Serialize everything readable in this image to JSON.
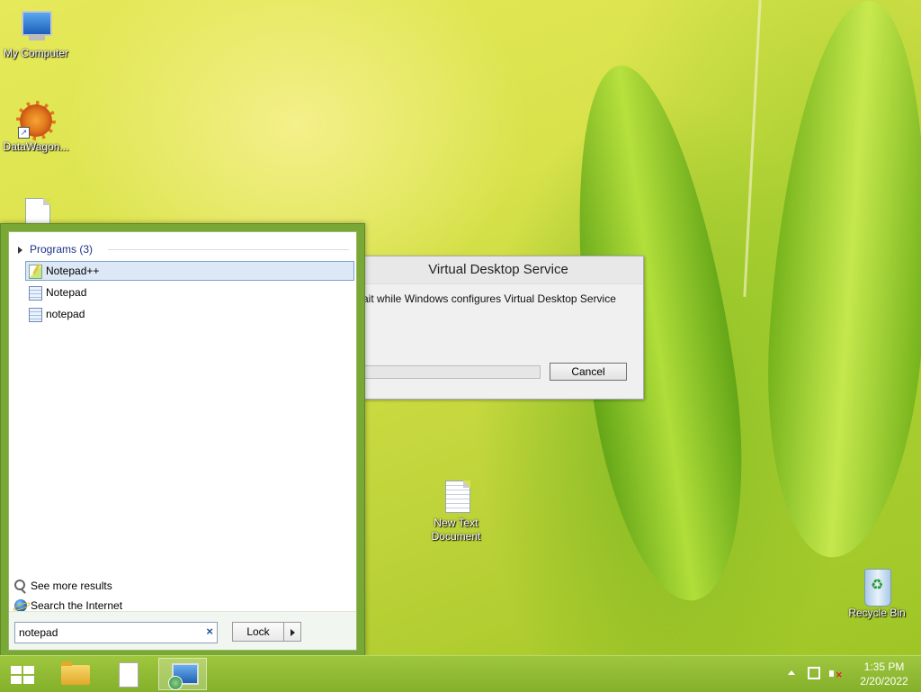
{
  "desktop": {
    "icons": [
      {
        "label": "My Computer"
      },
      {
        "label": "DataWagon..."
      },
      {
        "label": "New Text Document"
      },
      {
        "label": "Recycle Bin"
      }
    ]
  },
  "dialog": {
    "title": "Virtual Desktop Service",
    "message": "ait while Windows configures Virtual Desktop Service",
    "cancel_label": "Cancel",
    "progress": 0
  },
  "start_menu": {
    "group_label": "Programs (3)",
    "results": [
      {
        "label": "Notepad++",
        "icon": "notepad-plus-plus-icon",
        "selected": true
      },
      {
        "label": "Notepad",
        "icon": "notepad-icon",
        "selected": false
      },
      {
        "label": "notepad",
        "icon": "notepad-icon",
        "selected": false
      }
    ],
    "see_more": "See more results",
    "search_internet": "Search the Internet",
    "search_value": "notepad",
    "clear_glyph": "×",
    "lock_label": "Lock"
  },
  "taskbar": {
    "buttons": [
      "start-icon",
      "file-explorer-icon",
      "text-document-icon",
      "remote-desktop-icon"
    ],
    "time": "1:35 PM",
    "date": "2/20/2022"
  },
  "colors": {
    "taskbar": "#8fb832",
    "start_menu_frame": "#7aa836",
    "selection": "#dce8f5"
  }
}
